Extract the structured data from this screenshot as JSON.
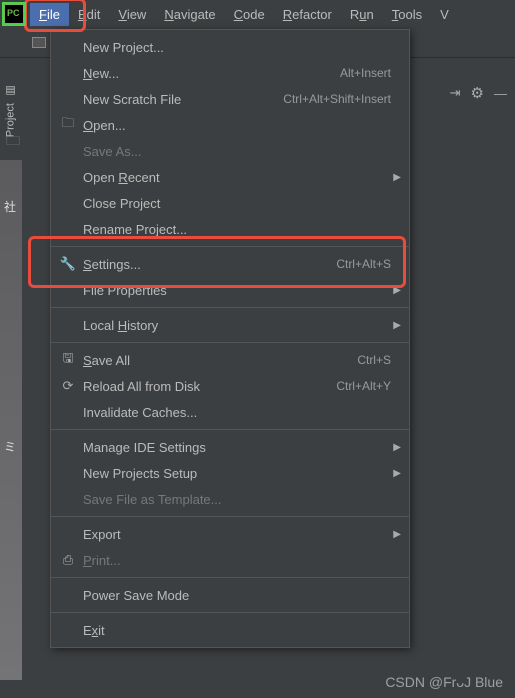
{
  "menubar": {
    "items": [
      {
        "label": "File",
        "mnemonic": "F",
        "active": true
      },
      {
        "label": "Edit",
        "mnemonic": "E"
      },
      {
        "label": "View",
        "mnemonic": "V"
      },
      {
        "label": "Navigate",
        "mnemonic": "N"
      },
      {
        "label": "Code",
        "mnemonic": "C"
      },
      {
        "label": "Refactor",
        "mnemonic": "R"
      },
      {
        "label": "Run",
        "mnemonic": "u"
      },
      {
        "label": "Tools",
        "mnemonic": "T"
      },
      {
        "label": "V",
        "mnemonic": ""
      }
    ]
  },
  "side_tab": "Project",
  "toolbar_right": {
    "divide": "⇥",
    "gear": "⚙",
    "hide": "—"
  },
  "file_menu": {
    "groups": [
      [
        {
          "label": "New Project...",
          "icon": "",
          "shortcut": "",
          "arrow": false,
          "disabled": false
        },
        {
          "label": "New...",
          "mnemonic_idx": 0,
          "icon": "",
          "shortcut": "Alt+Insert",
          "arrow": false,
          "disabled": false
        },
        {
          "label": "New Scratch File",
          "icon": "",
          "shortcut": "Ctrl+Alt+Shift+Insert",
          "arrow": false,
          "disabled": false
        },
        {
          "label": "Open...",
          "mnemonic_idx": 0,
          "icon": "folder",
          "shortcut": "",
          "arrow": false,
          "disabled": false
        },
        {
          "label": "Save As...",
          "icon": "",
          "shortcut": "",
          "arrow": false,
          "disabled": true
        },
        {
          "label": "Open Recent",
          "mnemonic_idx": 5,
          "icon": "",
          "shortcut": "",
          "arrow": true,
          "disabled": false
        },
        {
          "label": "Close Project",
          "icon": "",
          "shortcut": "",
          "arrow": false,
          "disabled": false
        },
        {
          "label": "Rename Project...",
          "icon": "",
          "shortcut": "",
          "arrow": false,
          "disabled": false
        }
      ],
      [
        {
          "label": "Settings...",
          "mnemonic_idx": 0,
          "icon": "wrench",
          "shortcut": "Ctrl+Alt+S",
          "arrow": false,
          "disabled": false
        },
        {
          "label": "File Properties",
          "icon": "",
          "shortcut": "",
          "arrow": true,
          "disabled": false
        }
      ],
      [
        {
          "label": "Local History",
          "mnemonic_idx": 6,
          "icon": "",
          "shortcut": "",
          "arrow": true,
          "disabled": false
        }
      ],
      [
        {
          "label": "Save All",
          "mnemonic_idx": 0,
          "icon": "save",
          "shortcut": "Ctrl+S",
          "arrow": false,
          "disabled": false
        },
        {
          "label": "Reload All from Disk",
          "icon": "reload",
          "shortcut": "Ctrl+Alt+Y",
          "arrow": false,
          "disabled": false
        },
        {
          "label": "Invalidate Caches...",
          "icon": "",
          "shortcut": "",
          "arrow": false,
          "disabled": false
        }
      ],
      [
        {
          "label": "Manage IDE Settings",
          "icon": "",
          "shortcut": "",
          "arrow": true,
          "disabled": false
        },
        {
          "label": "New Projects Setup",
          "icon": "",
          "shortcut": "",
          "arrow": true,
          "disabled": false
        },
        {
          "label": "Save File as Template...",
          "icon": "",
          "shortcut": "",
          "arrow": false,
          "disabled": true
        }
      ],
      [
        {
          "label": "Export",
          "icon": "",
          "shortcut": "",
          "arrow": true,
          "disabled": false
        },
        {
          "label": "Print...",
          "mnemonic_idx": 0,
          "icon": "print",
          "shortcut": "",
          "arrow": false,
          "disabled": true
        }
      ],
      [
        {
          "label": "Power Save Mode",
          "icon": "",
          "shortcut": "",
          "arrow": false,
          "disabled": false
        }
      ],
      [
        {
          "label": "Exit",
          "mnemonic_idx": 1,
          "icon": "",
          "shortcut": "",
          "arrow": false,
          "disabled": false
        }
      ]
    ]
  },
  "icons": {
    "folder": "🗀",
    "wrench": "🔧",
    "save": "🖫",
    "reload": "⟳",
    "print": "⎙"
  },
  "left_text": {
    "a": "社",
    "b": "ミ"
  },
  "watermark": "CSDN @FrᴗJ Blue"
}
